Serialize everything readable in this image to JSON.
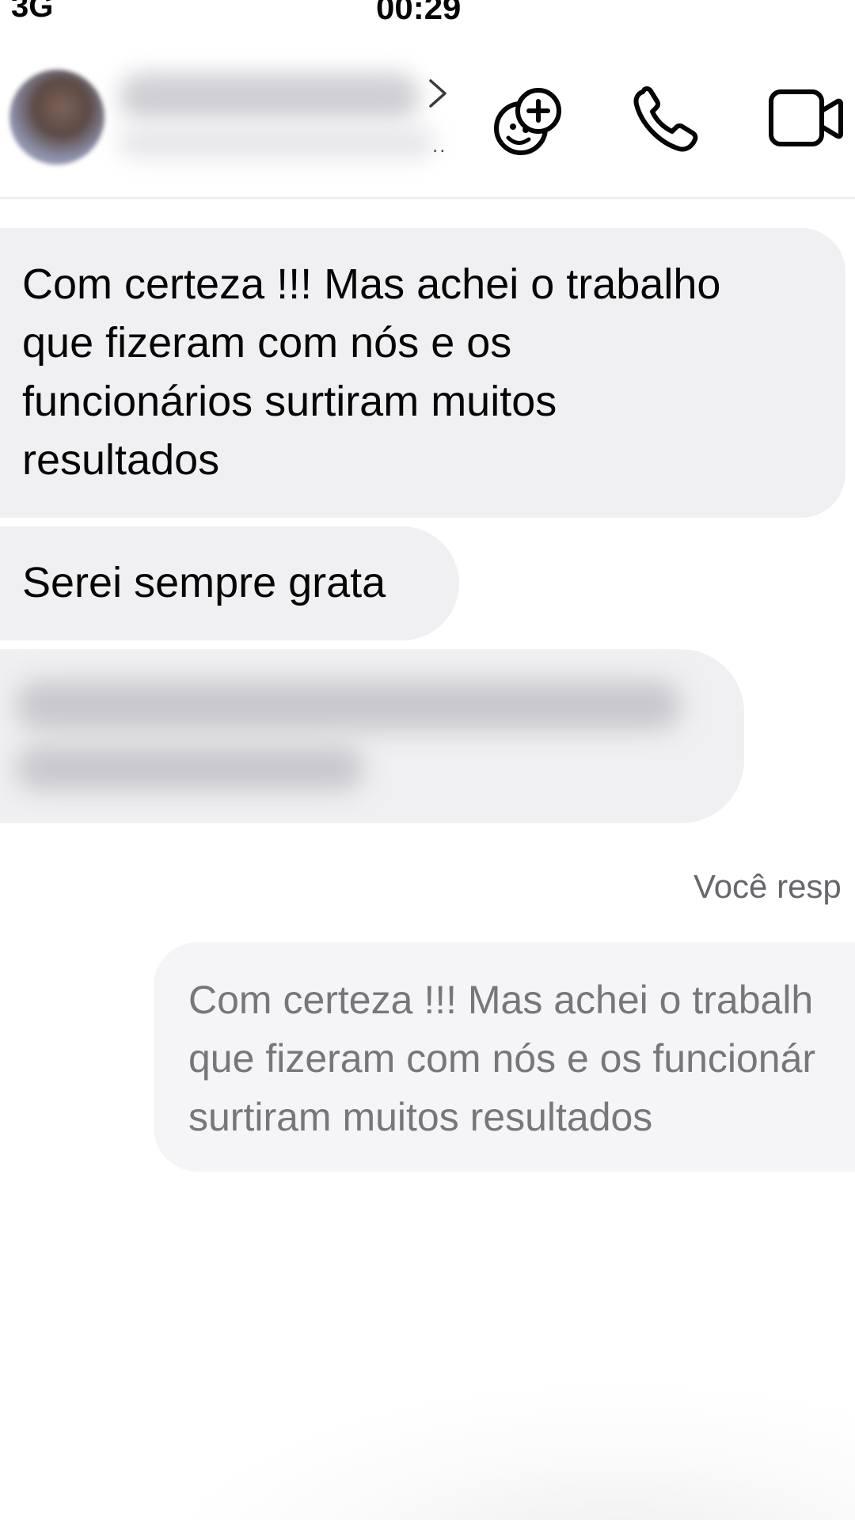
{
  "status_bar": {
    "network": "3G",
    "time": "00:29"
  },
  "header": {
    "contact_name": "",
    "contact_status": "",
    "ellipsis": "..",
    "icons": [
      "avatar",
      "chevron-right-icon",
      "effects-smiley-plus-icon",
      "phone-icon",
      "video-camera-icon"
    ]
  },
  "messages": [
    {
      "sender": "contact",
      "text": "Com certeza !!! Mas achei o trabalho que fizeram com nós e os funcionários surtiram muitos resultados",
      "lines": [
        "Com certeza !!! Mas achei o trabalho",
        "que fizeram com nós e os",
        "funcionários surtiram muitos",
        "resultados"
      ]
    },
    {
      "sender": "contact",
      "text": "Serei sempre grata"
    },
    {
      "sender": "contact",
      "text": "",
      "note": ""
    }
  ],
  "reply": {
    "label": "Você resp",
    "quoted_lines": [
      "Com certeza !!! Mas achei o trabalh",
      "que fizeram com nós e os funcionár",
      "surtiram muitos resultados"
    ]
  },
  "colors": {
    "incoming_bubble": "#f0f0f2",
    "reply_bubble": "#f5f5f7",
    "reply_text": "#76777b",
    "label_text": "#65676b",
    "divider": "#ececee"
  }
}
